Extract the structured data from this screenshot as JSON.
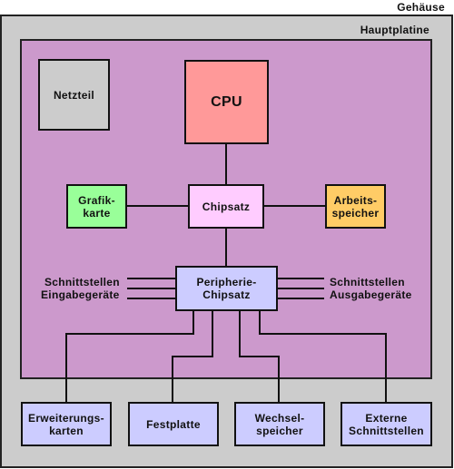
{
  "diagram": {
    "case_label": "Gehäuse",
    "board_label": "Hauptplatine",
    "components": {
      "psu": {
        "label": "Netzteil",
        "color": "#cccccc"
      },
      "cpu": {
        "label": "CPU",
        "color": "#ff9999"
      },
      "graphics": {
        "label": "Grafik-\nkarte",
        "color": "#99ff99"
      },
      "chipset": {
        "label": "Chipsatz",
        "color": "#ffccff"
      },
      "memory": {
        "label": "Arbeits-\nspeicher",
        "color": "#ffcc66"
      },
      "peripheral_chipset": {
        "label": "Peripherie-\nChipsatz",
        "color": "#ccccff"
      }
    },
    "interfaces": {
      "input_line1": "Schnittstellen",
      "input_line2": "Eingabegeräte",
      "output_line1": "Schnittstellen",
      "output_line2": "Ausgabegeräte"
    },
    "external": [
      {
        "label": "Erweiterungs-\nkarten",
        "color": "#ccccff"
      },
      {
        "label": "Festplatte",
        "color": "#ccccff"
      },
      {
        "label": "Wechsel-\nspeicher",
        "color": "#ccccff"
      },
      {
        "label": "Externe\nSchnittstellen",
        "color": "#ccccff"
      }
    ],
    "colors": {
      "case": "#cccccc",
      "board": "#cc99cc"
    }
  }
}
